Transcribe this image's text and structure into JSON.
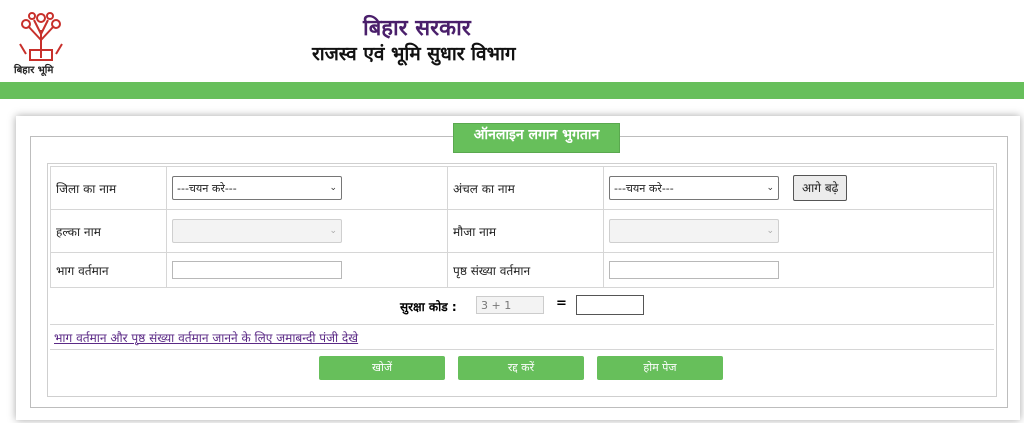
{
  "header": {
    "logo_text": "बिहार भूमि",
    "title": "बिहार सरकार",
    "subtitle": "राजस्व एवं भूमि सुधार विभाग",
    "accent": "#67bf5b"
  },
  "form": {
    "legend": "ऑनलाइन लगान भुगतान",
    "district_label": "जिला का नाम",
    "district_value": "---चयन करे---",
    "circle_label": "अंचल का नाम",
    "circle_value": "---चयन करे---",
    "next_button": "आगे बढ़े",
    "halka_label": "हल्का नाम",
    "mauja_label": "मौजा नाम",
    "bhag_label": "भाग वर्तमान",
    "page_label": "पृष्ठ संख्या वर्तमान",
    "captcha_label": "सुरक्षा कोड :",
    "captcha_value": "3 + 1",
    "equals": "=",
    "jamabandi_link": "भाग वर्तमान और पृष्ठ संख्या वर्तमान जानने के लिए जमाबन्दी पंजी देखे",
    "search_button": "खोजें",
    "cancel_button": "रद्द करें",
    "home_button": "होम पेज"
  }
}
